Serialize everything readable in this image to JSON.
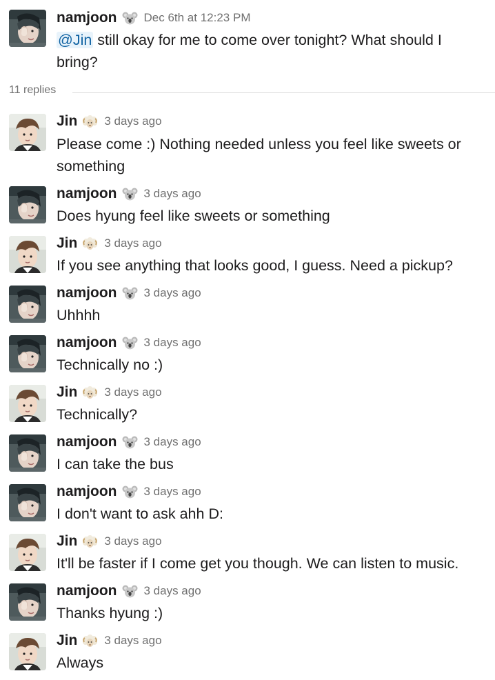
{
  "parent": {
    "author": "namjoon",
    "emoji": "koala-icon",
    "timestamp": "Dec 6th at 12:23 PM",
    "mention": "@Jin",
    "text": " still okay for me to come over tonight? What should I bring?"
  },
  "replies_label": "11 replies",
  "replies": [
    {
      "author": "Jin",
      "emoji": "sheep-icon",
      "time": "3 days ago",
      "text": "Please come :) Nothing needed unless you feel like sweets or something"
    },
    {
      "author": "namjoon",
      "emoji": "koala-icon",
      "time": "3 days ago",
      "text": "Does hyung feel like sweets or something"
    },
    {
      "author": "Jin",
      "emoji": "sheep-icon",
      "time": "3 days ago",
      "text": "If you see anything that looks good, I guess. Need a pickup?"
    },
    {
      "author": "namjoon",
      "emoji": "koala-icon",
      "time": "3 days ago",
      "text": "Uhhhh"
    },
    {
      "author": "namjoon",
      "emoji": "koala-icon",
      "time": "3 days ago",
      "text": "Technically no :)"
    },
    {
      "author": "Jin",
      "emoji": "sheep-icon",
      "time": "3 days ago",
      "text": "Technically?"
    },
    {
      "author": "namjoon",
      "emoji": "koala-icon",
      "time": "3 days ago",
      "text": "I can take the bus"
    },
    {
      "author": "namjoon",
      "emoji": "koala-icon",
      "time": "3 days ago",
      "text": "I don't want to ask ahh D:"
    },
    {
      "author": "Jin",
      "emoji": "sheep-icon",
      "time": "3 days ago",
      "text": "It'll be faster if I come get you though. We can listen to music."
    },
    {
      "author": "namjoon",
      "emoji": "koala-icon",
      "time": "3 days ago",
      "text": "Thanks hyung :)"
    },
    {
      "author": "Jin",
      "emoji": "sheep-icon",
      "time": "3 days ago",
      "text": "Always"
    }
  ]
}
